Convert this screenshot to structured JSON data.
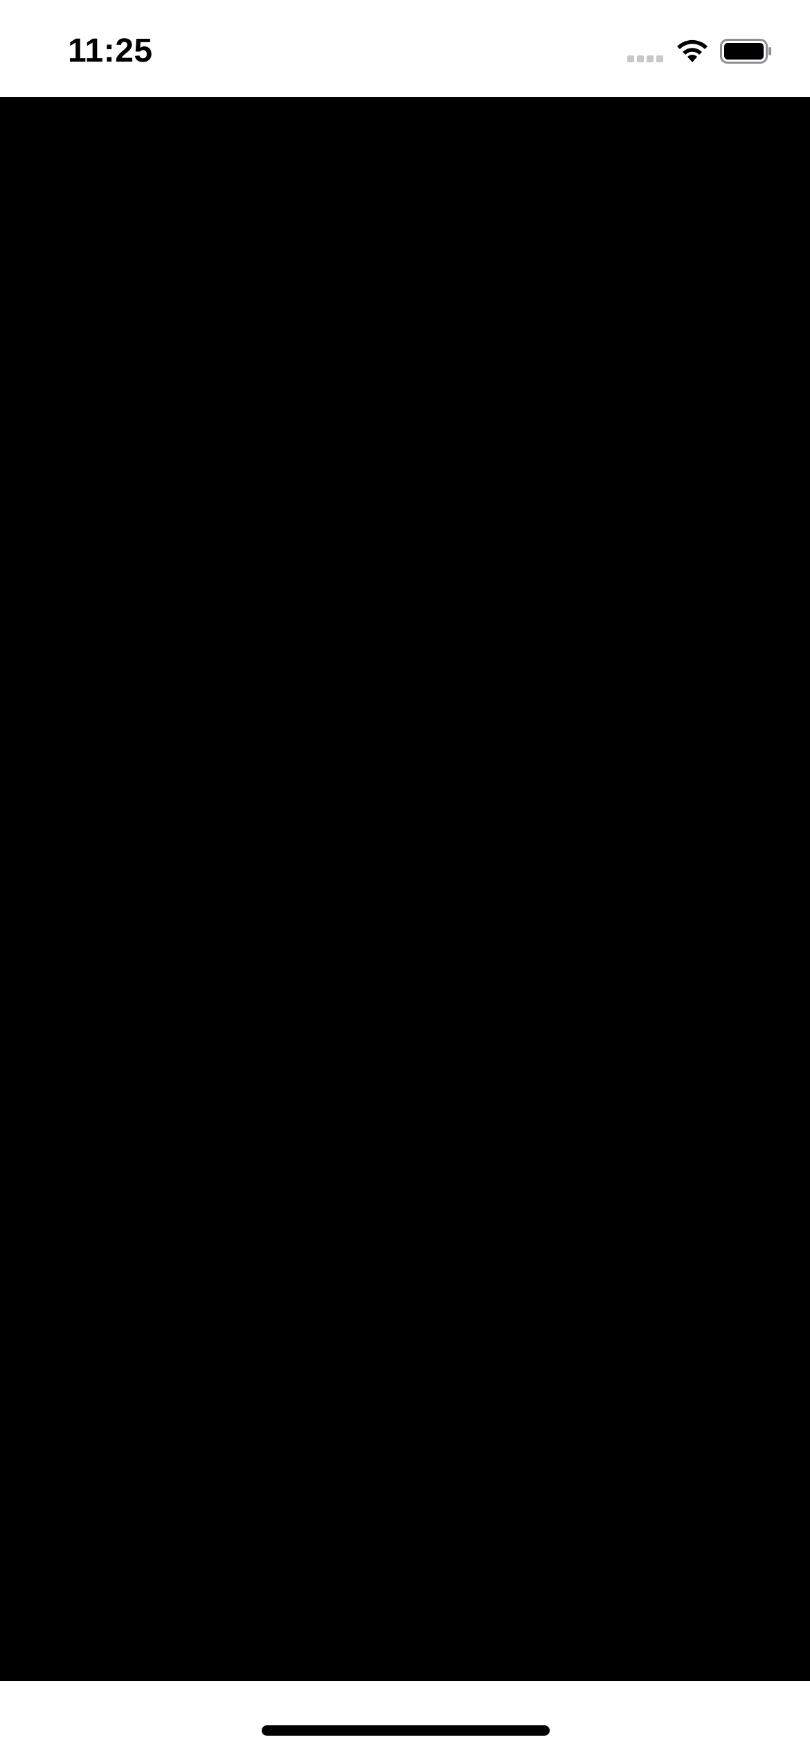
{
  "status_bar": {
    "time": "11:25",
    "signal_icon": "cellular-signal-icon",
    "wifi_icon": "wifi-icon",
    "battery_icon": "battery-icon",
    "signal_color": "#c7c7cc"
  },
  "content": {
    "background": "#000000"
  },
  "home_indicator": {
    "icon": "home-indicator"
  }
}
